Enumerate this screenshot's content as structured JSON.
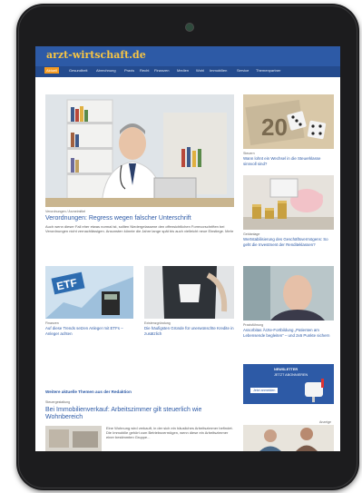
{
  "site": {
    "logo": "arzt-wirtschaft.de"
  },
  "nav": [
    "Aktuell",
    "Gesundheit",
    "Abrechnung",
    "Praxis",
    "Recht",
    "Finanzen",
    "Medien",
    "Wohl",
    "Immobilien",
    "Service",
    "Themenpartner"
  ],
  "lead": {
    "category": "Verordnungen / Arzneimittel",
    "title": "Verordnungen: Regress wegen falscher Unterschrift",
    "teaser": "Auch wenn dieser Fall eher etwas normal ist, sollten Niedergelassene den offensichtlichen Formvorschriften bei Verordnungen nicht vernachlässigen. Ansonsten könnte die Jahre lange spät bis auch vielleicht neue Einstiege. Mehr"
  },
  "side": [
    {
      "category": "Steuern",
      "title": "Wann lohnt ein Wechsel in die Steuerklasse sinnvoll sind?"
    },
    {
      "category": "Geldanlage",
      "title": "Wertstabilisierung des Geschäftsvermögens: So geht die Investment der Renditeklassen?"
    },
    {
      "category": "Praxisführung",
      "title": "Assorbitas Ärzte-Fortbildung „Patienten am Lebensende begleiten“ – und 2x6 Punkte sichern"
    }
  ],
  "grid": [
    {
      "category": "Finanzen",
      "title": "Auf diese Trends setzen Anleger mit ETFs – Anleger achten"
    },
    {
      "category": "Existenzgründung",
      "title": "Die häufigsten Gründe für unerwünschte Kredite in zusätzlich"
    }
  ],
  "section": {
    "title": "Weitere aktuelle Themen aus der Redaktion"
  },
  "bottom": {
    "category": "Steuergestaltung",
    "title": "Bei Immobilienverkauf: Arbeitszimmer gilt steuerlich wie Wohnbereich",
    "teaser": "Eine Wohnung wird verkauft, in der sich ein häusliches Arbeitszimmer befindet. Die Immobilie gehört zum Betriebsvermögen, wenn diese ein Arbeitszimmer einer bestimmten Gruppe..."
  },
  "ad": {
    "line1": "NEWSLETTER",
    "line2": "JETZT ABONNIEREN",
    "button": "Jetzt anmelden"
  },
  "ad2_label": "Anzeige",
  "colors": {
    "header": "#2d5aa6",
    "nav": "#244b8e",
    "logo": "#f7c544",
    "active": "#f39a21",
    "link": "#2d5aa6"
  }
}
